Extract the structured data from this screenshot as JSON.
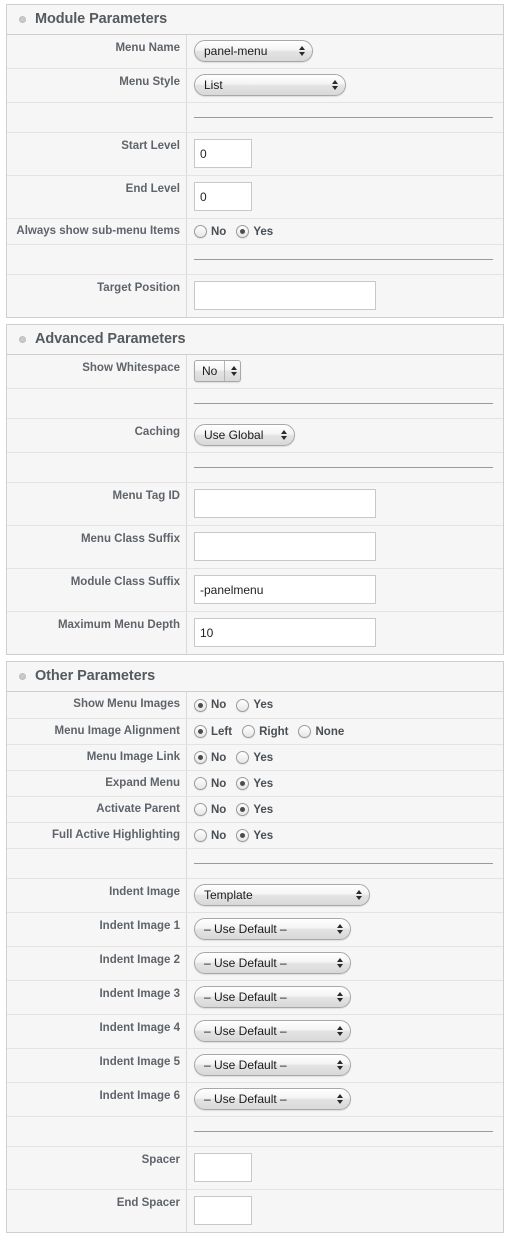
{
  "sections": [
    {
      "id": "module-parameters",
      "title": "Module Parameters",
      "rows": [
        {
          "type": "popup",
          "label": "Menu Name",
          "value": "panel-menu",
          "width": "w-menuname",
          "shape": "round"
        },
        {
          "type": "popup",
          "label": "Menu Style",
          "value": "List",
          "width": "w-menustyle",
          "shape": "round"
        },
        {
          "type": "divider",
          "label": ""
        },
        {
          "type": "text",
          "label": "Start Level",
          "value": "0",
          "placeholder": "",
          "width": "w-small"
        },
        {
          "type": "text",
          "label": "End Level",
          "value": "0",
          "placeholder": "",
          "width": "w-small"
        },
        {
          "type": "radio",
          "label": "Always show sub-menu Items",
          "options": [
            {
              "label": "No",
              "selected": false
            },
            {
              "label": "Yes",
              "selected": true
            }
          ]
        },
        {
          "type": "divider",
          "label": ""
        },
        {
          "type": "text",
          "label": "Target Position",
          "value": "",
          "placeholder": "",
          "width": "w-wide"
        }
      ]
    },
    {
      "id": "advanced-parameters",
      "title": "Advanced Parameters",
      "rows": [
        {
          "type": "popup",
          "label": "Show Whitespace",
          "value": "No",
          "width": "w-nows",
          "shape": "square"
        },
        {
          "type": "divider",
          "label": ""
        },
        {
          "type": "popup",
          "label": "Caching",
          "value": "Use Global",
          "width": "w-caching",
          "shape": "round"
        },
        {
          "type": "divider",
          "label": ""
        },
        {
          "type": "text",
          "label": "Menu Tag ID",
          "value": "",
          "placeholder": "",
          "width": "w-wide"
        },
        {
          "type": "text",
          "label": "Menu Class Suffix",
          "value": "",
          "placeholder": "",
          "width": "w-wide"
        },
        {
          "type": "text",
          "label": "Module Class Suffix",
          "value": "-panelmenu",
          "placeholder": "",
          "width": "w-wide"
        },
        {
          "type": "text",
          "label": "Maximum Menu Depth",
          "value": "10",
          "placeholder": "",
          "width": "w-wide"
        }
      ]
    },
    {
      "id": "other-parameters",
      "title": "Other Parameters",
      "rows": [
        {
          "type": "radio",
          "label": "Show Menu Images",
          "options": [
            {
              "label": "No",
              "selected": true
            },
            {
              "label": "Yes",
              "selected": false
            }
          ]
        },
        {
          "type": "radio",
          "label": "Menu Image Alignment",
          "options": [
            {
              "label": "Left",
              "selected": true
            },
            {
              "label": "Right",
              "selected": false
            },
            {
              "label": "None",
              "selected": false
            }
          ]
        },
        {
          "type": "radio",
          "label": "Menu Image Link",
          "options": [
            {
              "label": "No",
              "selected": true
            },
            {
              "label": "Yes",
              "selected": false
            }
          ]
        },
        {
          "type": "radio",
          "label": "Expand Menu",
          "options": [
            {
              "label": "No",
              "selected": false
            },
            {
              "label": "Yes",
              "selected": true
            }
          ]
        },
        {
          "type": "radio",
          "label": "Activate Parent",
          "options": [
            {
              "label": "No",
              "selected": false
            },
            {
              "label": "Yes",
              "selected": true
            }
          ]
        },
        {
          "type": "radio",
          "label": "Full Active Highlighting",
          "options": [
            {
              "label": "No",
              "selected": false
            },
            {
              "label": "Yes",
              "selected": true
            }
          ]
        },
        {
          "type": "divider",
          "label": ""
        },
        {
          "type": "popup",
          "label": "Indent Image",
          "value": "Template",
          "width": "w-indent",
          "shape": "round"
        },
        {
          "type": "popup",
          "label": "Indent Image 1",
          "value": "– Use Default –",
          "width": "w-indentn",
          "shape": "round"
        },
        {
          "type": "popup",
          "label": "Indent Image 2",
          "value": "– Use Default –",
          "width": "w-indentn",
          "shape": "round"
        },
        {
          "type": "popup",
          "label": "Indent Image 3",
          "value": "– Use Default –",
          "width": "w-indentn",
          "shape": "round"
        },
        {
          "type": "popup",
          "label": "Indent Image 4",
          "value": "– Use Default –",
          "width": "w-indentn",
          "shape": "round"
        },
        {
          "type": "popup",
          "label": "Indent Image 5",
          "value": "– Use Default –",
          "width": "w-indentn",
          "shape": "round"
        },
        {
          "type": "popup",
          "label": "Indent Image 6",
          "value": "– Use Default –",
          "width": "w-indentn",
          "shape": "round"
        },
        {
          "type": "divider",
          "label": ""
        },
        {
          "type": "text",
          "label": "Spacer",
          "value": "",
          "placeholder": "",
          "width": "w-small"
        },
        {
          "type": "text",
          "label": "End Spacer",
          "value": "",
          "placeholder": "",
          "width": "w-small"
        }
      ]
    }
  ],
  "icons": {
    "section_toggle": "toggle-dot-icon",
    "popup_arrows": "sort-arrows-icon"
  }
}
